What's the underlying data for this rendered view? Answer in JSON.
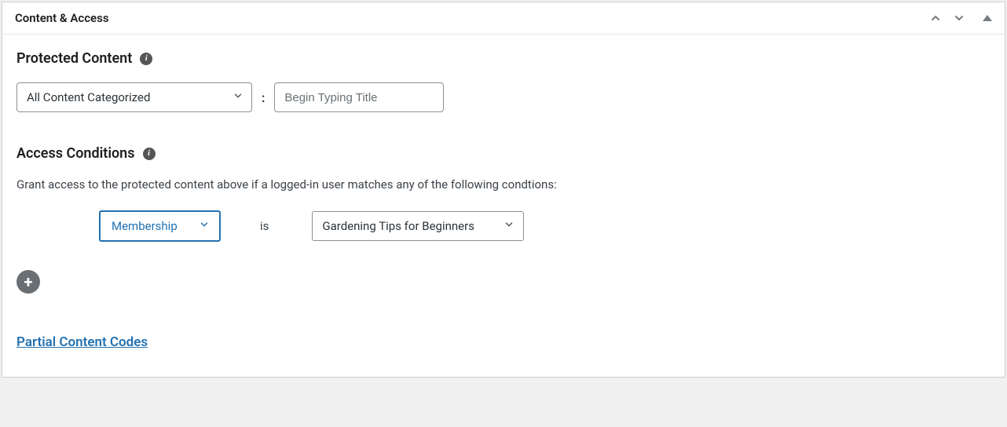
{
  "panel": {
    "title": "Content & Access"
  },
  "protected": {
    "heading": "Protected Content",
    "category_select": "All Content Categorized",
    "title_placeholder": "Begin Typing Title",
    "separator": ":"
  },
  "access": {
    "heading": "Access Conditions",
    "help": "Grant access to the protected content above if a logged-in user matches any of the following condtions:",
    "condition_type": "Membership",
    "operator": "is",
    "condition_value": "Gardening Tips for Beginners"
  },
  "link": {
    "label": "Partial Content Codes"
  },
  "icons": {
    "info": "i",
    "plus": "+"
  }
}
